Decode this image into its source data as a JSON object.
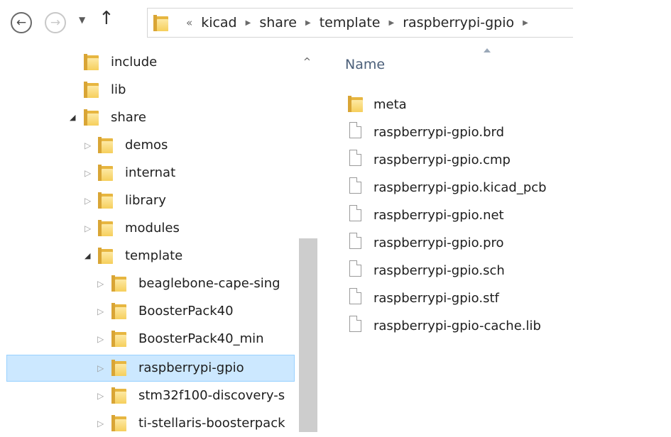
{
  "toolbar": {
    "back_glyph": "←",
    "forward_glyph": "→",
    "recent_glyph": "▼",
    "up_glyph": "↑",
    "overflow_glyph": "«",
    "separator_glyph": "›",
    "breadcrumbs": [
      "kicad",
      "share",
      "template",
      "raspberrypi-gpio"
    ]
  },
  "tree": {
    "items": [
      {
        "label": "include",
        "expander": ""
      },
      {
        "label": "lib",
        "expander": ""
      },
      {
        "label": "share",
        "expander": "◢"
      },
      {
        "label": "demos",
        "expander": "▷"
      },
      {
        "label": "internat",
        "expander": "▷"
      },
      {
        "label": "library",
        "expander": "▷"
      },
      {
        "label": "modules",
        "expander": "▷"
      },
      {
        "label": "template",
        "expander": "◢"
      },
      {
        "label": "beaglebone-cape-sing",
        "expander": "▷"
      },
      {
        "label": "BoosterPack40",
        "expander": "▷"
      },
      {
        "label": "BoosterPack40_min",
        "expander": "▷"
      },
      {
        "label": "raspberrypi-gpio",
        "expander": "▷"
      },
      {
        "label": "stm32f100-discovery-s",
        "expander": "▷"
      },
      {
        "label": "ti-stellaris-boosterpack",
        "expander": "▷"
      }
    ],
    "selected": "raspberrypi-gpio",
    "scroll_up_glyph": "^"
  },
  "list": {
    "column_name": "Name",
    "items": [
      {
        "label": "meta",
        "type": "folder"
      },
      {
        "label": "raspberrypi-gpio.brd",
        "type": "file"
      },
      {
        "label": "raspberrypi-gpio.cmp",
        "type": "file"
      },
      {
        "label": "raspberrypi-gpio.kicad_pcb",
        "type": "file"
      },
      {
        "label": "raspberrypi-gpio.net",
        "type": "file"
      },
      {
        "label": "raspberrypi-gpio.pro",
        "type": "file"
      },
      {
        "label": "raspberrypi-gpio.sch",
        "type": "file"
      },
      {
        "label": "raspberrypi-gpio.stf",
        "type": "file"
      },
      {
        "label": "raspberrypi-gpio-cache.lib",
        "type": "file"
      }
    ]
  },
  "colors": {
    "selection_bg": "#cce8ff",
    "selection_border": "#99d1ff",
    "folder": "#f6cf5c",
    "column_header": "#4c607a"
  }
}
